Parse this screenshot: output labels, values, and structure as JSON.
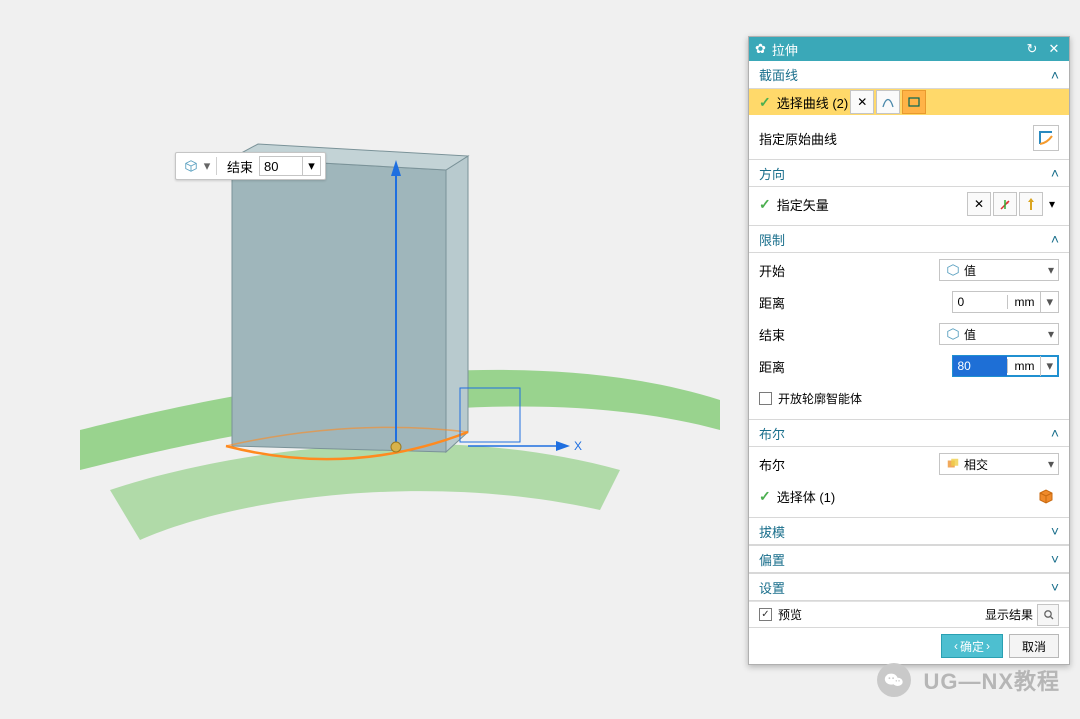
{
  "floatbar": {
    "end_label": "结束",
    "end_value": "80"
  },
  "panel": {
    "title": "拉伸",
    "sections": {
      "section1": {
        "title": "截面线",
        "select_curve": "选择曲线 (2)",
        "specify_orig": "指定原始曲线"
      },
      "direction": {
        "title": "方向",
        "specify_vector": "指定矢量"
      },
      "limit": {
        "title": "限制",
        "start_label": "开始",
        "start_option": "值",
        "start_dist_label": "距离",
        "start_dist_value": "0",
        "start_dist_unit": "mm",
        "end_label": "结束",
        "end_option": "值",
        "end_dist_label": "距离",
        "end_dist_value": "80",
        "end_dist_unit": "mm",
        "open_contour": "开放轮廓智能体"
      },
      "bool": {
        "title": "布尔",
        "bool_label": "布尔",
        "bool_option": "相交",
        "select_body": "选择体 (1)"
      },
      "draft": {
        "title": "拔模"
      },
      "offset": {
        "title": "偏置"
      },
      "settings": {
        "title": "设置"
      }
    },
    "footer": {
      "preview": "预览",
      "show_result": "显示结果",
      "ok": "确定",
      "cancel": "取消"
    }
  },
  "watermark": "UG—NX教程"
}
